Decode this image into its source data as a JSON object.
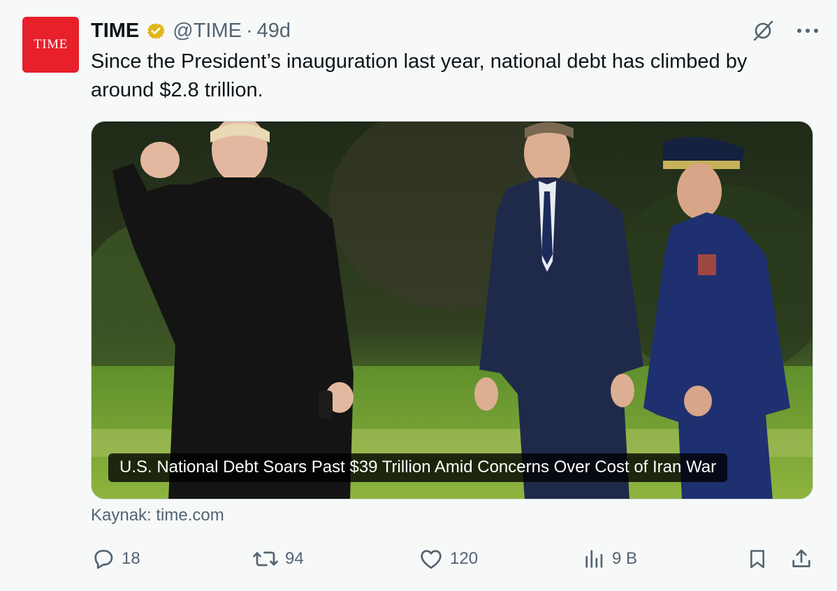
{
  "avatar": {
    "logo_text": "TIME",
    "bg_color": "#e8202a"
  },
  "header": {
    "name": "TIME",
    "handle": "@TIME",
    "separator": "·",
    "time": "49d",
    "verified_icon": "gold-verified-badge",
    "verified_color": "#e2b719"
  },
  "tweet": {
    "text": "Since the President’s inauguration last year, national debt has climbed by around $2.8 trillion."
  },
  "card": {
    "headline": "U.S. National Debt Soars Past $39 Trillion Amid Concerns Over Cost of Iran War",
    "image_description": "photo",
    "source": "Kaynak: time.com"
  },
  "actions": {
    "replies": "18",
    "reposts": "94",
    "likes": "120",
    "views": "9 B"
  },
  "icons": {
    "grok": "grok-icon",
    "more": "more-icon",
    "reply": "reply-icon",
    "repost": "repost-icon",
    "like": "heart-icon",
    "views": "views-icon",
    "bookmark": "bookmark-icon",
    "share": "share-icon"
  },
  "colors": {
    "text": "#0f1419",
    "secondary": "#536471",
    "background": "#f7f9f9"
  }
}
